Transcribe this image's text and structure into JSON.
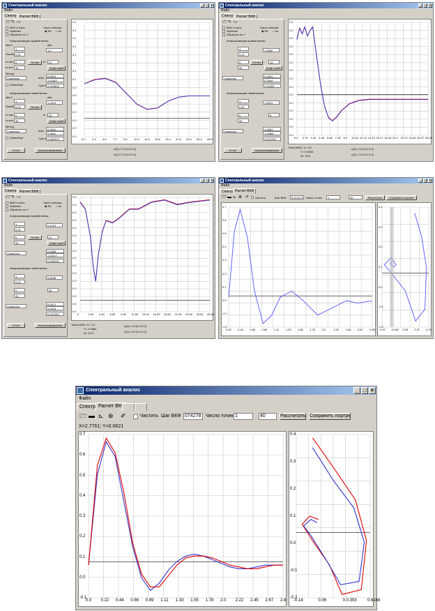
{
  "app_title": "Спектральный анализ",
  "menu_file": "Файл",
  "tab_spectrum": "Спектр",
  "tab_vkf": "Расчет ВКФ",
  "panels": {
    "max_zero": "MAX в нуль",
    "switches": "Switches",
    "invert_y": "Обратить по Y",
    "spectrum_part": "Часть спектра",
    "re": "Re",
    "im": "Im",
    "approx_right": "Аппроксимация правой ветвы",
    "approx_left": "Аппроксимация левой ветвы",
    "alfa0": "alfa 0",
    "alfa": "alfa",
    "error": "Ошибка",
    "optimize": "Оптим",
    "m_start": "m нач",
    "m_end": "m кон",
    "m": "m",
    "graph": "Граф ошиб",
    "method": "Метод",
    "simplex": "Симплекс",
    "levenberg": "Левенберг",
    "beta": "beta",
    "sum": "Сум.е",
    "report": "Отчет",
    "approximate": "Аппроксимировать",
    "curve_c": "c(2)= 0.0 (0.0 0.0)",
    "curve_s": "c(1)= 0.0 (0.0 0.0)"
  },
  "win1": {
    "alfa0": "1",
    "alfa": "1.0",
    "error": "0.01",
    "mstart": "0",
    "m": "22",
    "mend": "30",
    "beta1": "0.0531",
    "beta2": "-0.0163",
    "sum": "0.022893",
    "l_alfa0": "1",
    "l_alfa": "1.1619",
    "l_error": "0.01",
    "l_mstart": "0",
    "l_m": "30",
    "l_mend": "30",
    "l_beta1": "0.0841",
    "l_beta2": "0.0841",
    "l_sum": "0.082519",
    "yticks": [
      "0.1",
      "0.1",
      "0.1",
      "0.1",
      "0.1",
      "0.1",
      "0.1",
      "0.1",
      "0.0",
      "0.0",
      "0.0",
      "0.0",
      "0.0",
      "0.0",
      "0.0"
    ],
    "xticks": [
      "0.0",
      "2.4",
      "4.8",
      "7.2",
      "9.6",
      "12.0",
      "14.4",
      "16.8",
      "19.2",
      "21.6",
      "24.0",
      "26.4",
      "28.8"
    ],
    "point_label": "",
    "chart_data": {
      "type": "line",
      "series": [
        {
          "values": [
            0.045,
            0.06,
            0.065,
            0.05,
            0.01,
            -0.03,
            -0.05,
            -0.045,
            -0.02,
            -0.005,
            0.0,
            0.0,
            0.0
          ]
        }
      ]
    }
  },
  "win2": {
    "alfa0": "1",
    "alfa": "1.5636",
    "error": "0.01",
    "mstart": "0",
    "m": "14",
    "mend": "30",
    "beta1": "0.1661",
    "beta2": "0.7844",
    "sum": "0.02452",
    "l_alfa0": "1",
    "l_alfa": "1.5301",
    "l_error": "0.01",
    "l_mstart": "0",
    "l_m": "6",
    "l_mend": "30",
    "l_beta1": "1.1681",
    "l_beta2": "-0.0569",
    "l_sum": "0.007220",
    "point_info": [
      "Точка MAX:  X= 3.2",
      "Y= 0.0554",
      "N= 16.0"
    ],
    "yticks": [
      "0.0",
      "0.0",
      "0.0",
      "0.0",
      "0.0",
      "0.0",
      "0.0",
      "0.0",
      "0.0",
      "0.0",
      "0.0",
      "0.0",
      "0.0",
      "0.0",
      "0.0"
    ],
    "xticks": [
      "0.0",
      "0.79",
      "2.42",
      "4.05",
      "5.66",
      "7.28",
      "8.9",
      "10.51",
      "12.13",
      "14.15",
      "16.17",
      "18.18",
      "20.2",
      "22.22",
      "24.24",
      "26.27",
      "28.29"
    ]
  },
  "win3": {
    "alfa0": "1",
    "alfa": "0.4723",
    "error": "0.01",
    "mstart": "0",
    "m": "22",
    "mend": "30",
    "beta1": "0.0665",
    "beta2": "-0.0217",
    "sum": "0.006205",
    "l_alfa0": "1",
    "l_alfa": "0.6036",
    "l_error": "0.01",
    "l_mstart": "0",
    "l_m": "30",
    "l_mend": "30",
    "l_beta1": "0.0971",
    "l_beta2": "0.2219",
    "l_sum": "0.047052",
    "point_info": [
      "Точка MAX:  X= 4.4",
      "Y= 0.0684",
      "N= 22.0"
    ],
    "yticks": [
      "0.0",
      "0.0",
      "0.0",
      "0.0",
      "0.0",
      "0.0",
      "0.0",
      "0.0",
      "0.0",
      "0.0",
      "0.0",
      "0.0",
      "0.0",
      "0.0",
      "0.0",
      "0.0"
    ],
    "xticks": [
      "0",
      "2.04",
      "4.40",
      "6.60",
      "9.35",
      "11.60",
      "14.04",
      "16.39",
      "18.82",
      "21.26",
      "23.69",
      "26.04",
      "28.48"
    ]
  },
  "win4": {
    "toolbar": {
      "clear": "Чистить",
      "step_label": "Шаг ВКФ",
      "step": "0.074271",
      "points_label": "Число точек",
      "points_a": "1",
      "points_b": "40",
      "compute": "Рассчитать",
      "save": "Сохранить портрет"
    },
    "xticks": [
      "0.22",
      "0.44",
      "0.66",
      "0.89",
      "1.11",
      "1.33",
      "1.55",
      "1.78",
      "2.0",
      "2.22",
      "2.45",
      "2.67",
      "2.89"
    ],
    "yticks": [
      "0.7",
      "0.6",
      "0.5",
      "0.4",
      "0.3",
      "0.2",
      "0.1",
      "0.0",
      "-0.1",
      "-0.2"
    ],
    "px_xticks": [
      "-0.37",
      "-0.052",
      "0.25",
      "0.47",
      "0.76"
    ],
    "px_yticks": [
      "0.4",
      "0.3",
      "0.2",
      "0.1",
      "0.0",
      "-0.1",
      "-0.2"
    ]
  },
  "win5": {
    "toolbar": {
      "clear": "Чистить",
      "step_label": "Шаг ВКФ",
      "step": "074278",
      "points_label": "Число точек",
      "points_a": "1",
      "points_b": "40",
      "compute": "Рассчитать",
      "save": "Сохранить портрет"
    },
    "coord": "X=2.7761; Y=0.0621",
    "xticks": [
      "0.0",
      "0.22",
      "0.44",
      "0.66",
      "0.89",
      "1.11",
      "1.33",
      "1.55",
      "1.78",
      "2.0",
      "2.22",
      "2.45",
      "2.67",
      "2.8"
    ],
    "yticks": [
      "0.7",
      "0.6",
      "0.5",
      "0.4",
      "0.3",
      "0.2",
      "0.1",
      "0.0",
      "-0.1"
    ],
    "px_xticks": [
      "-0.14",
      "0.06",
      "0.0.393",
      "0.6168"
    ],
    "px_yticks": [
      "0.4",
      "0.3",
      "0.2",
      "0.1",
      "0.0",
      "-0.1",
      "-0.2"
    ],
    "chart_data": {
      "type": "line",
      "x": [
        0.0,
        0.11,
        0.22,
        0.33,
        0.44,
        0.55,
        0.66,
        0.77,
        0.89,
        1.0,
        1.11,
        1.22,
        1.33,
        1.44,
        1.55,
        1.66,
        1.78,
        1.89,
        2.0,
        2.22,
        2.45,
        2.67,
        2.8
      ],
      "series": [
        {
          "values": [
            0.0,
            0.5,
            0.68,
            0.6,
            0.35,
            0.1,
            -0.07,
            -0.14,
            -0.1,
            -0.03,
            0.02,
            0.05,
            0.06,
            0.05,
            0.03,
            0.01,
            -0.01,
            -0.02,
            -0.02,
            -0.01,
            0.0,
            0.0,
            0.0
          ]
        },
        {
          "values": [
            0.0,
            0.55,
            0.7,
            0.62,
            0.4,
            0.12,
            -0.05,
            -0.12,
            -0.12,
            -0.06,
            0.0,
            0.04,
            0.05,
            0.05,
            0.04,
            0.02,
            0.0,
            -0.01,
            -0.02,
            -0.02,
            -0.01,
            0.0,
            0.0
          ]
        }
      ]
    }
  }
}
